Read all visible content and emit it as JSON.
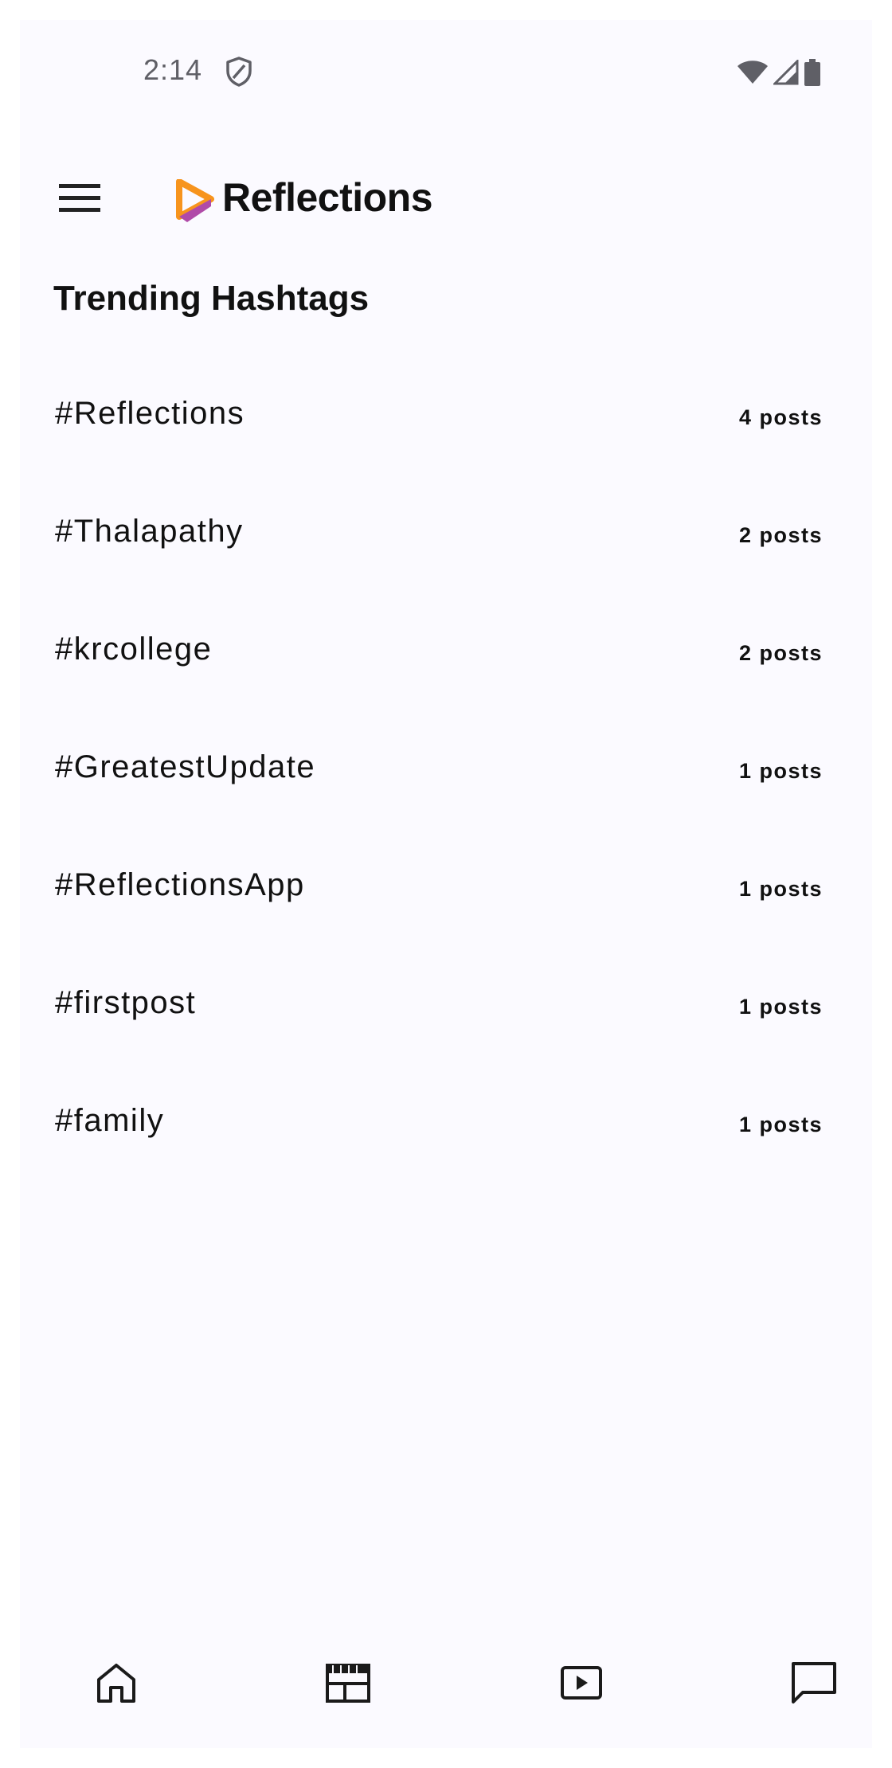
{
  "status_bar": {
    "time": "2:14",
    "icons": [
      "shield-icon",
      "wifi-icon",
      "cellular-signal-icon",
      "battery-icon"
    ]
  },
  "app_bar": {
    "title": "Reflections",
    "menu_icon": "menu-icon",
    "logo_icon": "reflections-logo-icon"
  },
  "section": {
    "title": "Trending Hashtags"
  },
  "hashtags": [
    {
      "tag": "#Reflections",
      "count": "4 posts"
    },
    {
      "tag": "#Thalapathy",
      "count": "2 posts"
    },
    {
      "tag": "#krcollege",
      "count": "2 posts"
    },
    {
      "tag": "#GreatestUpdate",
      "count": "1 posts"
    },
    {
      "tag": "#ReflectionsApp",
      "count": "1 posts"
    },
    {
      "tag": "#firstpost",
      "count": "1 posts"
    },
    {
      "tag": "#family",
      "count": "1 posts"
    }
  ],
  "bottom_nav": {
    "items": [
      "home-icon",
      "feed-icon",
      "video-icon",
      "chat-icon"
    ]
  },
  "colors": {
    "background": "#fbfaff",
    "text": "#111111",
    "logo_orange": "#f7941d",
    "logo_purple": "#b04aa8"
  }
}
